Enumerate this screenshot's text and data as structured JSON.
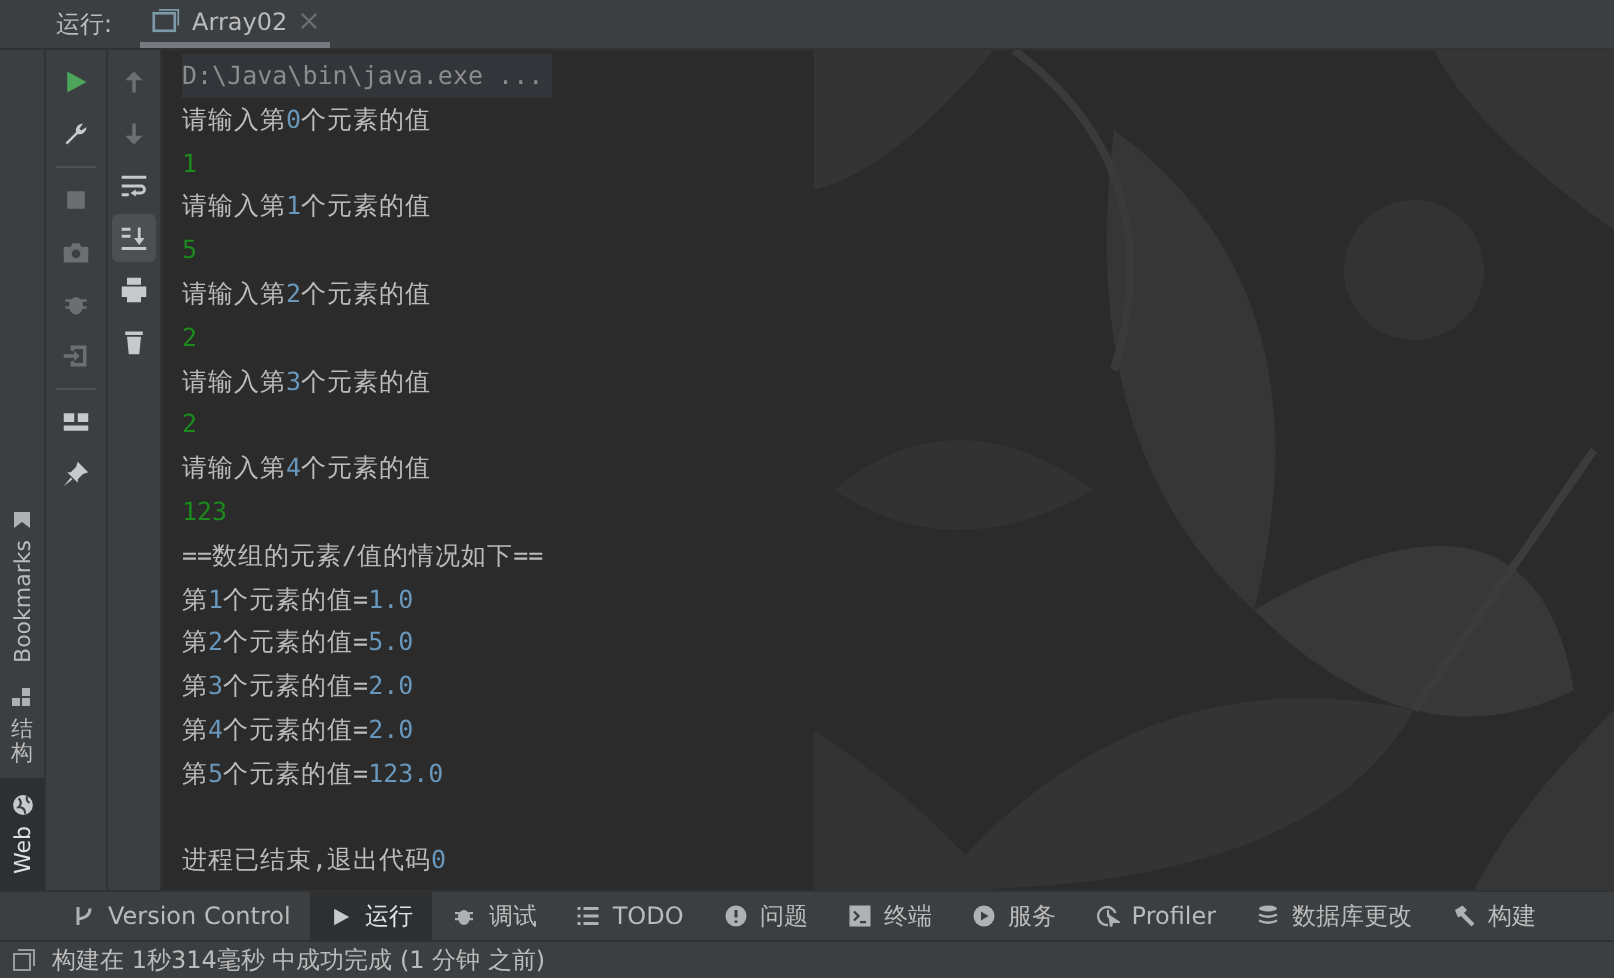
{
  "run_panel": {
    "label": "运行:",
    "tab": {
      "title": "Array02",
      "selected": true
    }
  },
  "side_labels": [
    {
      "label": "Bookmarks",
      "kind": "bookmark"
    },
    {
      "label": "结构",
      "kind": "structure"
    },
    {
      "label": "Web",
      "kind": "web"
    }
  ],
  "toolbar_left": [
    {
      "kind": "run",
      "disabled": false
    },
    {
      "kind": "wrench",
      "disabled": false
    },
    {
      "kind": "stop",
      "disabled": true
    },
    {
      "kind": "camera",
      "disabled": true
    },
    {
      "kind": "bug",
      "disabled": true
    },
    {
      "kind": "exit",
      "disabled": true
    },
    {
      "kind": "layout",
      "disabled": false
    },
    {
      "kind": "pin",
      "disabled": false
    }
  ],
  "toolbar_right": [
    {
      "kind": "up",
      "disabled": true,
      "selected": false
    },
    {
      "kind": "down",
      "disabled": true,
      "selected": false
    },
    {
      "kind": "wrap",
      "disabled": false,
      "selected": false
    },
    {
      "kind": "scroll-end",
      "disabled": false,
      "selected": true
    },
    {
      "kind": "print",
      "disabled": false,
      "selected": false
    },
    {
      "kind": "trash",
      "disabled": false,
      "selected": false
    }
  ],
  "console": [
    {
      "kind": "command",
      "text": "D:\\Java\\bin\\java.exe ..."
    },
    {
      "kind": "output",
      "text": "请输入第0个元素的值"
    },
    {
      "kind": "input",
      "text": "1"
    },
    {
      "kind": "output",
      "text": "请输入第1个元素的值"
    },
    {
      "kind": "input",
      "text": "5"
    },
    {
      "kind": "output",
      "text": "请输入第2个元素的值"
    },
    {
      "kind": "input",
      "text": "2"
    },
    {
      "kind": "output",
      "text": "请输入第3个元素的值"
    },
    {
      "kind": "input",
      "text": "2"
    },
    {
      "kind": "output",
      "text": "请输入第4个元素的值"
    },
    {
      "kind": "input",
      "text": "123"
    },
    {
      "kind": "output",
      "text": "==数组的元素/值的情况如下=="
    },
    {
      "kind": "output",
      "text": "第1个元素的值=1.0"
    },
    {
      "kind": "output",
      "text": "第2个元素的值=5.0"
    },
    {
      "kind": "output",
      "text": "第3个元素的值=2.0"
    },
    {
      "kind": "output",
      "text": "第4个元素的值=2.0"
    },
    {
      "kind": "output",
      "text": "第5个元素的值=123.0"
    },
    {
      "kind": "blank"
    },
    {
      "kind": "output",
      "text": "进程已结束,退出代码0"
    }
  ],
  "bottom_tabs": [
    {
      "label": "Version Control",
      "kind": "vcs",
      "selected": false
    },
    {
      "label": "运行",
      "kind": "run",
      "selected": true
    },
    {
      "label": "调试",
      "kind": "bug",
      "selected": false
    },
    {
      "label": "TODO",
      "kind": "list",
      "selected": false
    },
    {
      "label": "问题",
      "kind": "problem",
      "selected": false
    },
    {
      "label": "终端",
      "kind": "terminal",
      "selected": false
    },
    {
      "label": "服务",
      "kind": "service",
      "selected": false
    },
    {
      "label": "Profiler",
      "kind": "profiler",
      "selected": false
    },
    {
      "label": "数据库更改",
      "kind": "db",
      "selected": false
    },
    {
      "label": "构建",
      "kind": "hammer",
      "selected": false
    }
  ],
  "status_bar": {
    "message": "构建在 1秒314毫秒 中成功完成 (1 分钟 之前)"
  }
}
